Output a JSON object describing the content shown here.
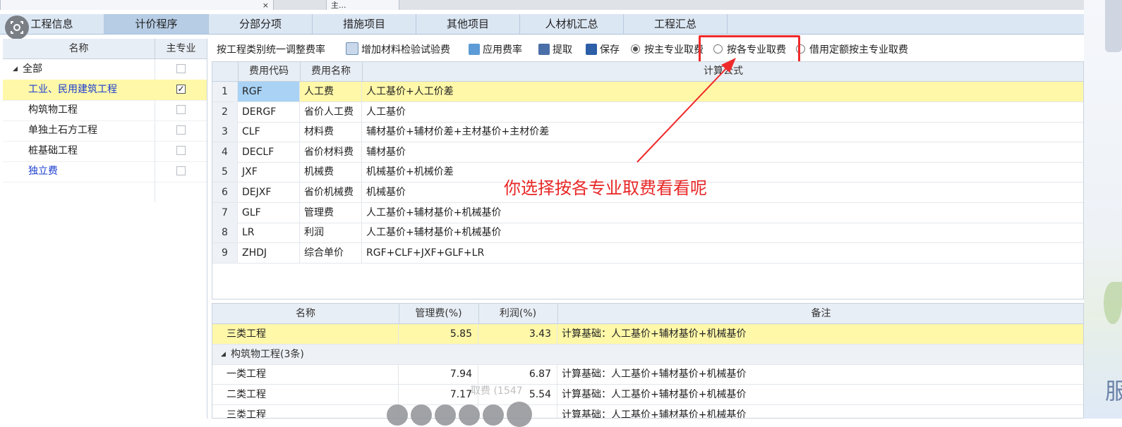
{
  "window_tabs": [
    "",
    "主..."
  ],
  "tabs": [
    "工程信息",
    "计价程序",
    "分部分项",
    "措施项目",
    "其他项目",
    "人材机汇总",
    "工程汇总"
  ],
  "active_tab": 1,
  "left_panel": {
    "headers": {
      "name": "名称",
      "main_specialty": "主专业"
    },
    "rows": [
      {
        "label": "全部",
        "checked": false
      },
      {
        "label": "工业、民用建筑工程",
        "checked": true,
        "check_mark": "✓"
      },
      {
        "label": "构筑物工程",
        "checked": false
      },
      {
        "label": "单独土石方工程",
        "checked": false
      },
      {
        "label": "桩基础工程",
        "checked": false
      },
      {
        "label": "独立费",
        "checked": false
      }
    ]
  },
  "toolbar": {
    "adjust_rate": "按工程类别统一调整费率",
    "add_material_test_fee": "增加材料检验试验费",
    "apply_rate": "应用费率",
    "extract": "提取",
    "save": "保存",
    "radio_main_specialty": "按主专业取费",
    "radio_each_specialty": "按各专业取费",
    "radio_borrow_quota": "借用定额按主专业取费",
    "selected_radio": "radio_main_specialty"
  },
  "upper_grid": {
    "headers": {
      "code": "费用代码",
      "name": "费用名称",
      "formula": "计算公式"
    },
    "rows": [
      {
        "n": "1",
        "code": "RGF",
        "name": "人工费",
        "formula": "人工基价+人工价差"
      },
      {
        "n": "2",
        "code": "DERGF",
        "name": "省价人工费",
        "formula": "人工基价"
      },
      {
        "n": "3",
        "code": "CLF",
        "name": "材料费",
        "formula": "辅材基价+辅材价差+主材基价+主材价差"
      },
      {
        "n": "4",
        "code": "DECLF",
        "name": "省价材料费",
        "formula": "辅材基价"
      },
      {
        "n": "5",
        "code": "JXF",
        "name": "机械费",
        "formula": "机械基价+机械价差"
      },
      {
        "n": "6",
        "code": "DEJXF",
        "name": "省价机械费",
        "formula": "机械基价"
      },
      {
        "n": "7",
        "code": "GLF",
        "name": "管理费",
        "formula": "人工基价+辅材基价+机械基价"
      },
      {
        "n": "8",
        "code": "LR",
        "name": "利润",
        "formula": "人工基价+辅材基价+机械基价"
      },
      {
        "n": "9",
        "code": "ZHDJ",
        "name": "综合单价",
        "formula": "RGF+CLF+JXF+GLF+LR"
      }
    ]
  },
  "annotation": "你选择按各专业取费看看呢",
  "lower_grid": {
    "headers": {
      "name": "名称",
      "mgmt_fee": "管理费(%)",
      "profit": "利润(%)",
      "remark": "备注"
    },
    "rows": [
      {
        "type": "row",
        "name": "三类工程",
        "mgmt_fee": "5.85",
        "profit": "3.43",
        "remark": "计算基础：人工基价+辅材基价+机械基价",
        "selected": true
      },
      {
        "type": "group",
        "name": "构筑物工程(3条)"
      },
      {
        "type": "row",
        "name": "一类工程",
        "mgmt_fee": "7.94",
        "profit": "6.87",
        "remark": "计算基础：人工基价+辅材基价+机械基价"
      },
      {
        "type": "row",
        "name": "二类工程",
        "mgmt_fee": "7.17",
        "profit": "5.54",
        "remark": "计算基础：人工基价+辅材基价+机械基价"
      },
      {
        "type": "row",
        "name": "三类工程",
        "mgmt_fee": "",
        "profit": "",
        "remark": "计算基础：人工基价+辅材基价+机械基价"
      }
    ]
  },
  "overlay_caption": "取费 (1547",
  "side_text": "服",
  "colors": {
    "selected_row": "#fff8a8",
    "annotation": "#e82626",
    "tab_active": "#b7cde5",
    "selected_cell": "#a9d2f5"
  },
  "icons": [
    "screenshot-icon",
    "adjust-rate-icon",
    "apply-rate-icon",
    "extract-icon",
    "save-icon"
  ]
}
